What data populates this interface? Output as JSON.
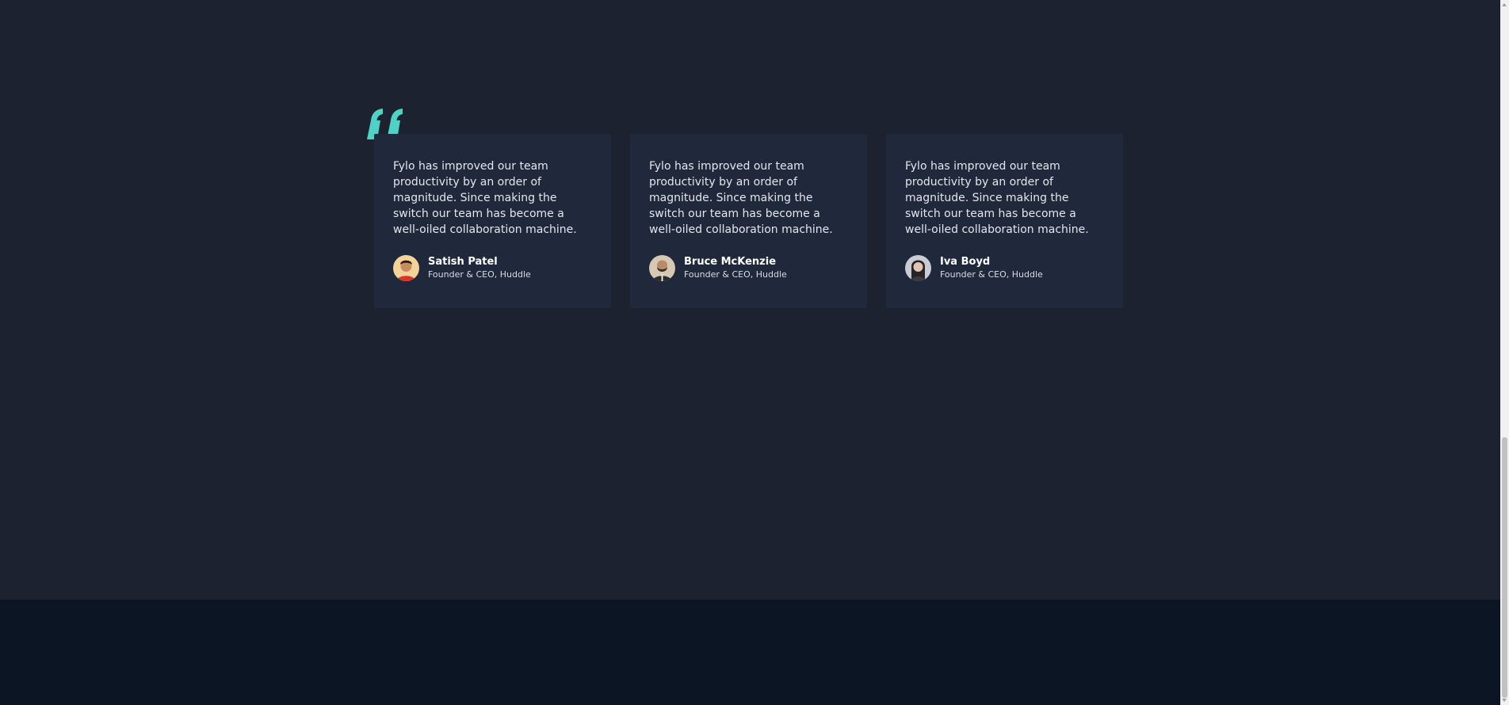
{
  "colors": {
    "section_bg": "#1c2230",
    "card_bg": "#20293c",
    "footer_bg": "#0c1524",
    "accent": "#4fd1c5"
  },
  "icons": {
    "quote": "quote-icon"
  },
  "testimonials": [
    {
      "quote": "Fylo has improved our team productivity by an order of magnitude. Since making the switch our team has become a well-oiled collaboration machine.",
      "name": "Satish Patel",
      "role": "Founder & CEO, Huddle"
    },
    {
      "quote": "Fylo has improved our team productivity by an order of magnitude. Since making the switch our team has become a well-oiled collaboration machine.",
      "name": "Bruce McKenzie",
      "role": "Founder & CEO, Huddle"
    },
    {
      "quote": "Fylo has improved our team productivity by an order of magnitude. Since making the switch our team has become a well-oiled collaboration machine.",
      "name": "Iva Boyd",
      "role": "Founder & CEO, Huddle"
    }
  ]
}
